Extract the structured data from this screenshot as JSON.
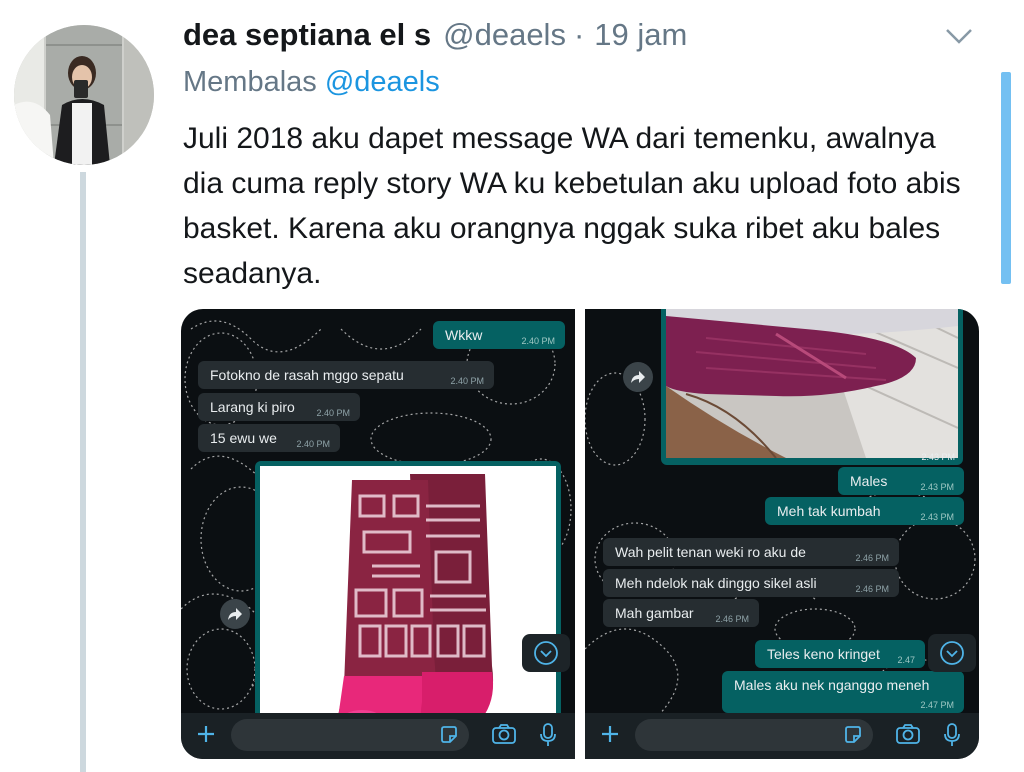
{
  "tweet": {
    "display_name": "dea septiana el s",
    "handle": "@deaels",
    "separator": "·",
    "time": "19 jam",
    "reply_prefix": "Membalas",
    "reply_to": "@deaels",
    "text": "Juli 2018 aku dapet message WA dari temenku, awalnya dia cuma reply story WA ku kebetulan aku upload foto abis basket. Karena aku orangnya nggak suka ribet aku bales seadanya."
  },
  "screenshot_left": {
    "messages": [
      {
        "dir": "out",
        "text": "Wkkw",
        "time": "2.40 PM"
      },
      {
        "dir": "in",
        "text": "Fotokno de rasah mggo sepatu",
        "time": "2.40 PM"
      },
      {
        "dir": "in",
        "text": "Larang ki piro",
        "time": "2.40 PM"
      },
      {
        "dir": "in",
        "text": "15 ewu we",
        "time": "2.40 PM"
      }
    ]
  },
  "screenshot_right": {
    "photo_time": "2.43 PM",
    "messages": [
      {
        "dir": "out",
        "text": "Males",
        "time": "2.43 PM"
      },
      {
        "dir": "out",
        "text": "Meh tak kumbah",
        "time": "2.43 PM"
      },
      {
        "dir": "in",
        "text": "Wah pelit tenan weki ro aku de",
        "time": "2.46 PM"
      },
      {
        "dir": "in",
        "text": "Meh ndelok nak dinggo sikel asli",
        "time": "2.46 PM"
      },
      {
        "dir": "in",
        "text": "Mah gambar",
        "time": "2.46 PM"
      },
      {
        "dir": "out",
        "text": "Teles keno kringet",
        "time": "2.47"
      },
      {
        "dir": "out",
        "text": "Males aku nek nganggo meneh",
        "time": "2.47 PM"
      }
    ]
  },
  "icons": {
    "chevron": "chevron-down-icon",
    "forward": "forward-icon",
    "scroll_down": "scroll-down-icon",
    "attach": "plus-icon",
    "sticker": "sticker-icon",
    "camera": "camera-icon",
    "mic": "mic-icon"
  },
  "colors": {
    "link": "#1b95e0",
    "muted": "#657786",
    "wa_outgoing": "#056162",
    "wa_incoming": "#262d31"
  }
}
